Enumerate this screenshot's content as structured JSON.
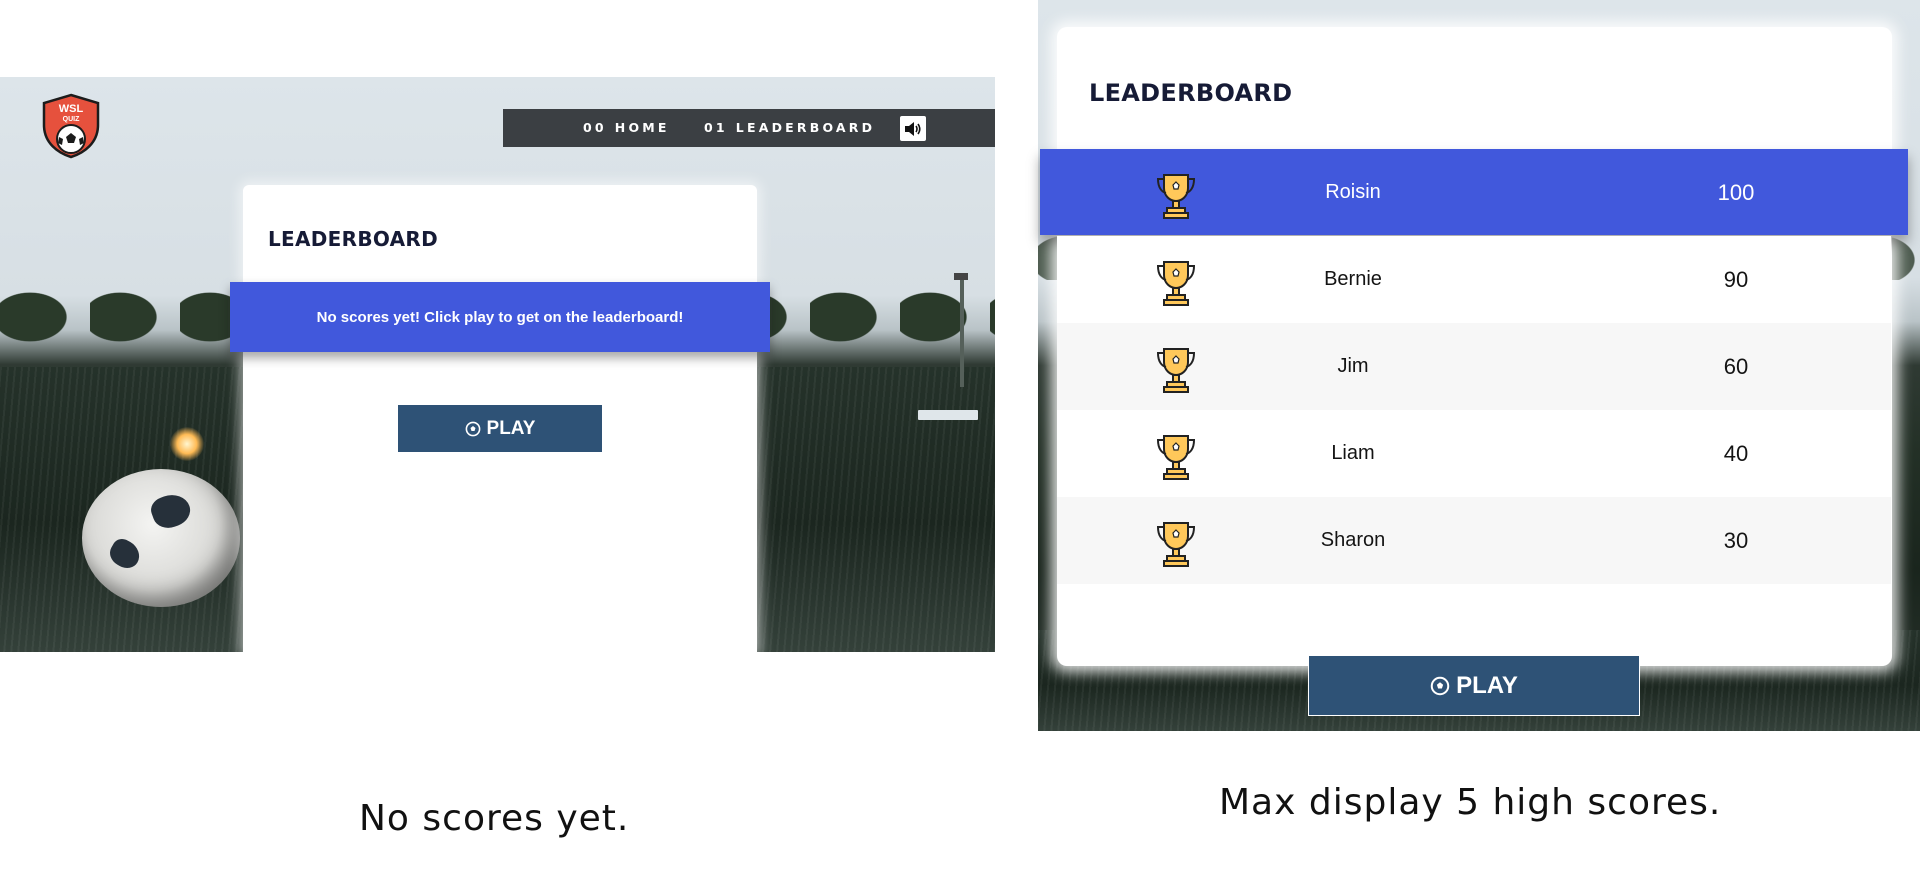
{
  "left_panel": {
    "logo": {
      "line1": "WSL",
      "line2": "QUIZ",
      "icon": "shield-soccer-ball-logo"
    },
    "nav": {
      "home": {
        "number": "00",
        "label": "HOME"
      },
      "leaderboard": {
        "number": "01",
        "label": "LEADERBOARD"
      },
      "sound_icon": "speaker-volume-icon"
    },
    "card": {
      "title": "LEADERBOARD",
      "banner_text": "No scores yet! Click play to get on the leaderboard!",
      "play_label": "PLAY",
      "play_icon": "soccer-ball-icon"
    },
    "caption": "No scores yet."
  },
  "right_panel": {
    "card": {
      "title": "LEADERBOARD",
      "scores": [
        {
          "name": "Roisin",
          "score": "100",
          "icon": "trophy-icon"
        },
        {
          "name": "Bernie",
          "score": "90",
          "icon": "trophy-icon"
        },
        {
          "name": "Jim",
          "score": "60",
          "icon": "trophy-icon"
        },
        {
          "name": "Liam",
          "score": "40",
          "icon": "trophy-icon"
        },
        {
          "name": "Sharon",
          "score": "30",
          "icon": "trophy-icon"
        }
      ],
      "play_label": "PLAY",
      "play_icon": "soccer-ball-icon"
    },
    "caption": "Max display 5 high scores."
  },
  "colors": {
    "accent_blue": "#4158dc",
    "play_button": "#2e5276",
    "nav_bar": "#3b3f43",
    "title_text": "#161b36"
  }
}
